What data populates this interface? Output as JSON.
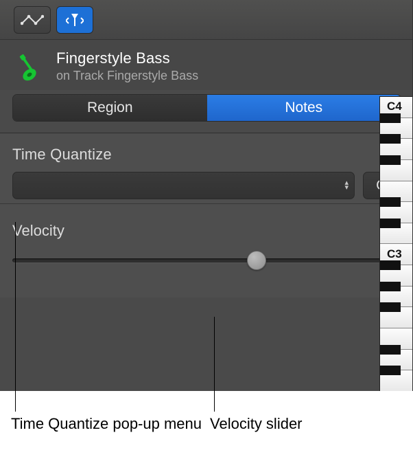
{
  "track": {
    "title": "Fingerstyle Bass",
    "subtitle": "on Track Fingerstyle Bass"
  },
  "tabs": {
    "region": "Region",
    "notes": "Notes",
    "active": "notes"
  },
  "quantize": {
    "label": "Time Quantize",
    "button": "Q",
    "value": ""
  },
  "velocity": {
    "label": "Velocity",
    "value": 80,
    "min": 0,
    "max": 127,
    "thumb_percent": 63
  },
  "piano": {
    "labels": [
      "C4",
      "C3"
    ]
  },
  "annotations": {
    "a": "Time Quantize pop-up menu",
    "b": "Velocity slider"
  }
}
